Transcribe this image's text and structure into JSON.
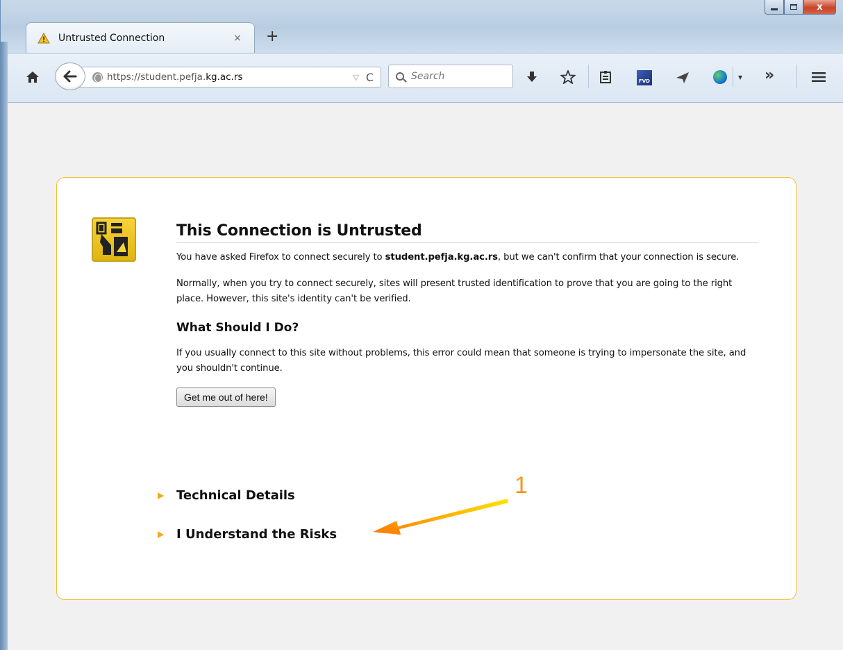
{
  "window": {
    "minimize_icon": "minimize-icon",
    "maximize_icon": "maximize-icon",
    "close_label": "x"
  },
  "tab": {
    "title": "Untrusted Connection",
    "close_glyph": "×",
    "new_tab_glyph": "+"
  },
  "toolbar": {
    "url_prefix": "https://student.pefja.",
    "url_domain": "kg.ac.rs",
    "url_dropdown_glyph": "▽",
    "reload_glyph": "C",
    "search_placeholder": "Search",
    "pvd_label": "FVD",
    "overflow_glyph": "»",
    "menu_glyph": "≡",
    "ext_dropdown_glyph": "▾"
  },
  "error": {
    "title": "This Connection is Untrusted",
    "p1_before": "You have asked Firefox to connect securely to ",
    "p1_host": "student.pefja.kg.ac.rs",
    "p1_after": ", but we can't confirm that your connection is secure.",
    "p2": "Normally, when you try to connect securely, sites will present trusted identification to prove that you are going to the right place. However, this site's identity can't be verified.",
    "subheading": "What Should I Do?",
    "p3": "If you usually connect to this site without problems, this error could mean that someone is trying to impersonate the site, and you shouldn't continue.",
    "button_label": "Get me out of here!",
    "expander1": "Technical Details",
    "expander2": "I Understand the Risks"
  },
  "annotation": {
    "number": "1",
    "color": "#f7941d"
  },
  "colors": {
    "card_border": "#f0c036",
    "badge_yellow": "#f8d23a",
    "expander_triangle": "#f4a81c"
  }
}
